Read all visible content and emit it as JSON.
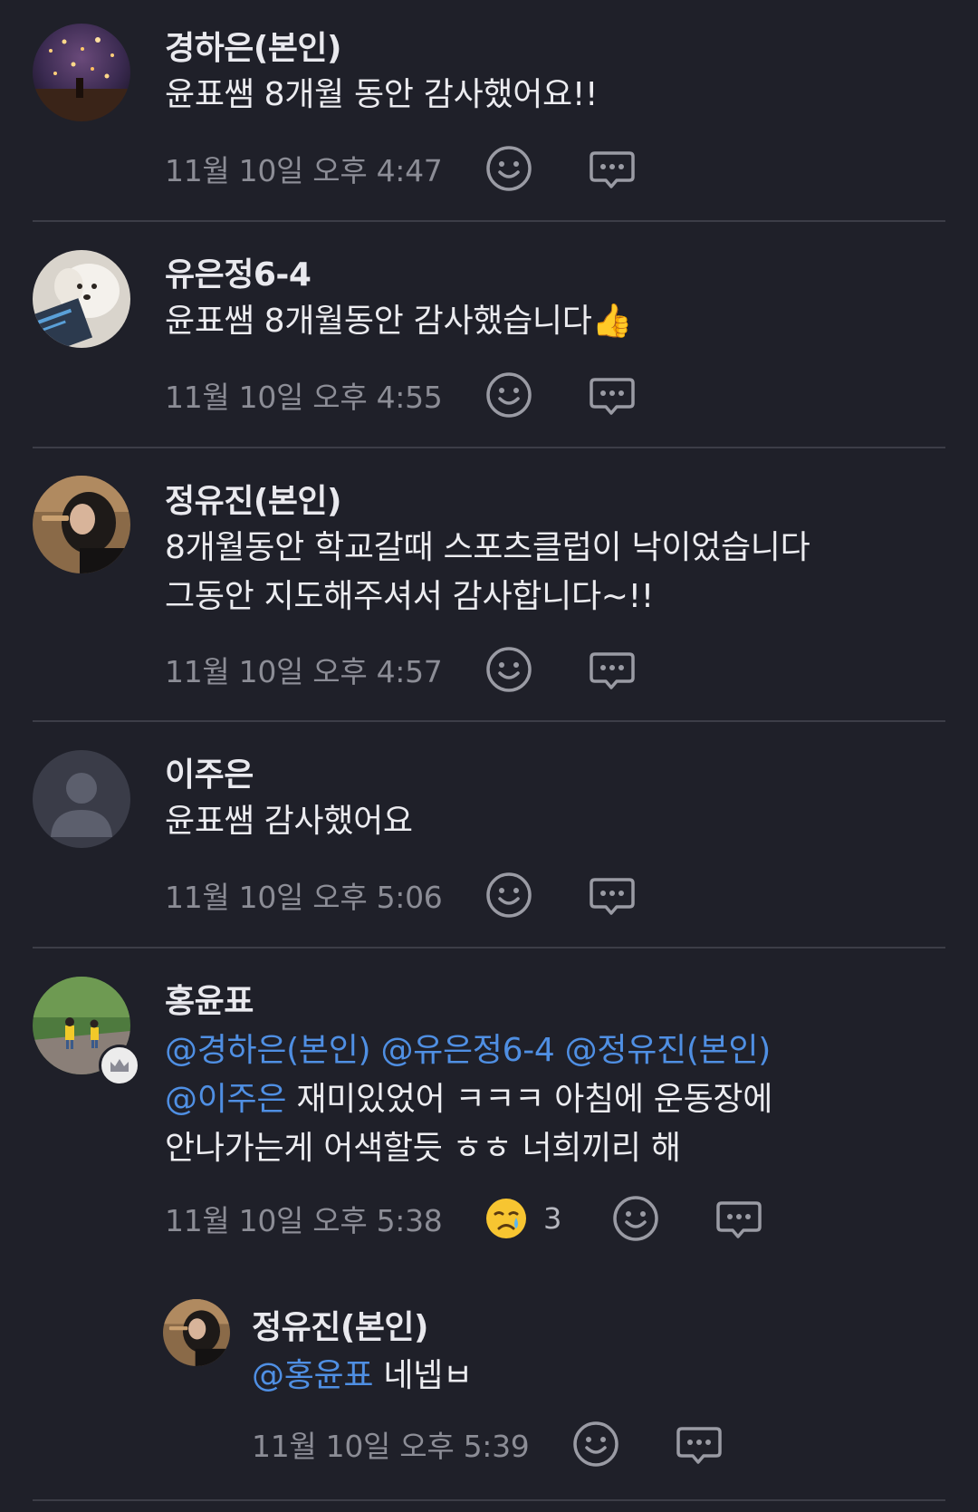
{
  "comments": [
    {
      "author": "경하은(본인)",
      "lines": [
        "윤표쌤 8개월 동안 감사했어요!!"
      ],
      "time": "11월 10일 오후 4:47"
    },
    {
      "author": "유은정6-4",
      "lines": [
        "윤표쌤 8개월동안 감사했습니다"
      ],
      "emoji": "👍",
      "time": "11월 10일 오후 4:55"
    },
    {
      "author": "정유진(본인)",
      "lines": [
        "8개월동안 학교갈때 스포츠클럽이 낙이었습니다",
        "그동안 지도해주셔서 감사합니다~!!"
      ],
      "time": "11월 10일 오후 4:57"
    },
    {
      "author": "이주은",
      "lines": [
        "윤표쌤 감사했어요"
      ],
      "time": "11월 10일 오후 5:06"
    },
    {
      "author": "홍윤표",
      "mentions": [
        "@경하은(본인)",
        "@유은정6-4",
        "@정유진(본인)",
        "@이주은"
      ],
      "text_after_mentions": "재미있었어 ㅋㅋㅋ 아침에 운동장에",
      "line3": "안나가는게 어색할듯 ㅎㅎ 너희끼리 해",
      "time": "11월 10일 오후 5:38",
      "reaction": {
        "icon": "crying-face-icon",
        "count": "3"
      }
    }
  ],
  "reply": {
    "author": "정유진(본인)",
    "mention": "@홍윤표",
    "text": "네넵ㅂ",
    "time": "11월 10일 오후 5:39"
  },
  "colors": {
    "background": "#1f2029",
    "mention": "#4f8fe3",
    "timestamp": "#8c8d96",
    "divider": "#3c3d47"
  }
}
